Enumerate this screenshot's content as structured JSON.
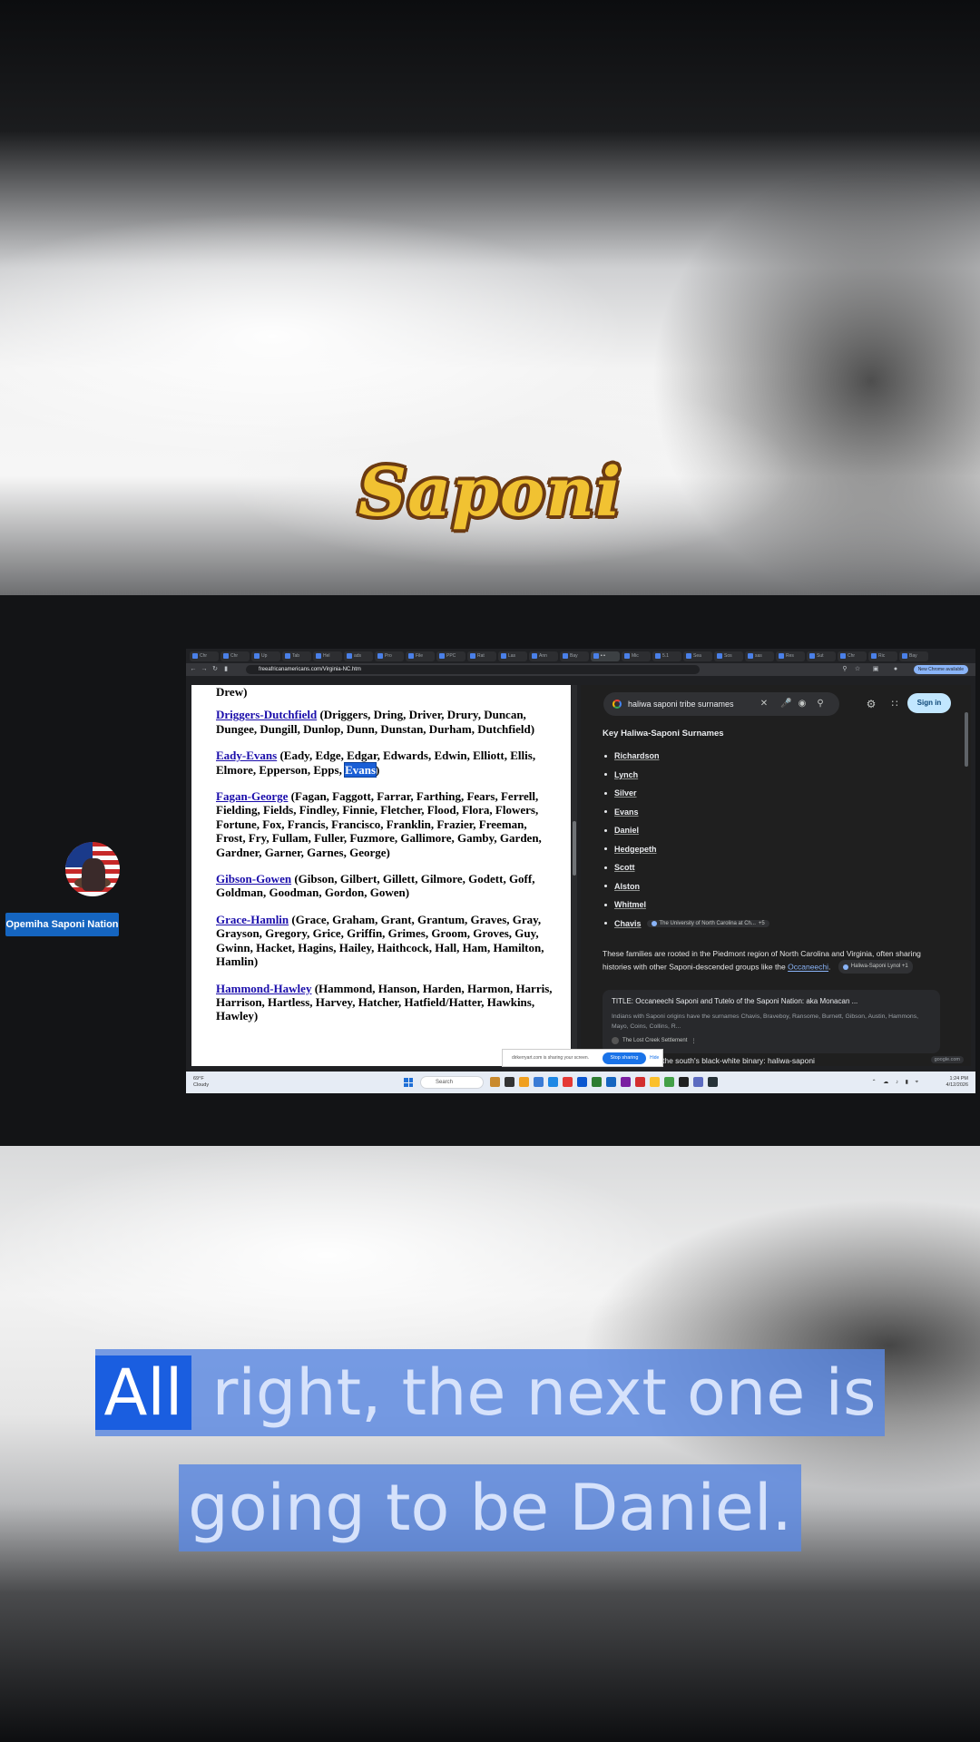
{
  "overlay": {
    "title": "Saponi",
    "participant_name": "Opemiha Saponi Nation",
    "caption_line1_highlight": "All",
    "caption_line1_rest": "right, the next one is",
    "caption_line2": "going to be Daniel."
  },
  "browser": {
    "url": "freeafricanamericans.com/Virginia-NC.htm",
    "new_chrome_badge": "New Chrome available",
    "tabs": [
      "Chr",
      "Chr",
      "Up",
      "Tab",
      "Hel",
      "ads",
      "Pro",
      "File",
      "PPC",
      "Rat",
      "Las",
      "Ann",
      "Bay",
      "• •",
      "Mic",
      "5.1",
      "Sea",
      "Sos",
      "sas",
      "Res",
      "Sut",
      "Chr",
      "Ric",
      "Bay"
    ]
  },
  "left_page": {
    "entry0_tail": "Drew)",
    "entries": [
      {
        "link": "Driggers-Dutchfield",
        "names": " (Driggers, Dring, Driver, Drury, Duncan, Dungee, Dungill, Dunlop, Dunn, Dunstan, Durham, Dutchfield)"
      },
      {
        "link": "Eady-Evans",
        "names_before": " (Eady, Edge, Edgar, Edwards, Edwin, Elliott, Ellis, Elmore, Epperson, Epps, ",
        "highlight": "Evans",
        "names_after": ")"
      },
      {
        "link": "Fagan-George",
        "names": " (Fagan, Faggott, Farrar, Farthing, Fears, Ferrell, Fielding, Fields, Findley, Finnie, Fletcher, Flood, Flora, Flowers, Fortune, Fox, Francis, Francisco, Franklin, Frazier, Freeman, Frost, Fry, Fullam, Fuller, Fuzmore, Gallimore, Gamby, Garden, Gardner, Garner, Garnes, George)"
      },
      {
        "link": "Gibson-Gowen",
        "names": " (Gibson, Gilbert, Gillett, Gilmore, Godett, Goff, Goldman, Goodman, Gordon, Gowen)"
      },
      {
        "link": "Grace-Hamlin",
        "names": " (Grace, Graham, Grant, Grantum, Graves, Gray, Grayson, Gregory, Grice, Griffin, Grimes, Groom, Groves, Guy, Gwinn, Hacket, Hagins, Hailey, Haithcock, Hall, Ham, Hamilton, Hamlin)"
      },
      {
        "link": "Hammond-Hawley",
        "names": " (Hammond, Hanson, Harden, Harmon, Harris, Harrison, Hartless, Harvey, Hatcher, Hatfield/Hatter, Hawkins, Hawley)"
      }
    ]
  },
  "right_page": {
    "query": "haliwa saponi tribe surnames",
    "sign_in": "Sign in",
    "heading": "Key Haliwa-Saponi Surnames",
    "surnames": [
      "Richardson",
      "Lynch",
      "Silver",
      "Evans",
      "Daniel",
      "Hedgepeth",
      "Scott",
      "Alston",
      "Whitmel",
      "Chavis"
    ],
    "chavis_citation": "The University of North Carolina at Ch...",
    "chavis_citation_more": "+5",
    "paragraph": "These families are rooted in the Piedmont region of North Carolina and Virginia, often sharing histories with other Saponi-descended groups like the",
    "paragraph_link": "Occaneechi",
    "paragraph_end": ".",
    "paragraph_citation": "Haliwa-Saponi Lynol +1",
    "card_title": "TITLE: Occaneechi Saponi and Tutelo of the Saponi Nation: aka Monacan ...",
    "card_text": "Indians with Saponi origins have the surnames Chavis, Braveboy, Ransome, Burnett, Gibson, Austin, Hammons, Mayo, Coins, Collins, R...",
    "card_source": "The Lost Creek Settlement",
    "more_text": "the south's black-white binary: haliwa-saponi",
    "google_badge": "google.com"
  },
  "share_bar": {
    "text": "dirkerryart.com is sharing your screen.",
    "stop": "Stop sharing",
    "hide": "Hide"
  },
  "taskbar": {
    "weather_temp": "69°F",
    "weather_desc": "Cloudy",
    "search_placeholder": "Search",
    "time": "1:24 PM",
    "date": "4/12/2026"
  }
}
